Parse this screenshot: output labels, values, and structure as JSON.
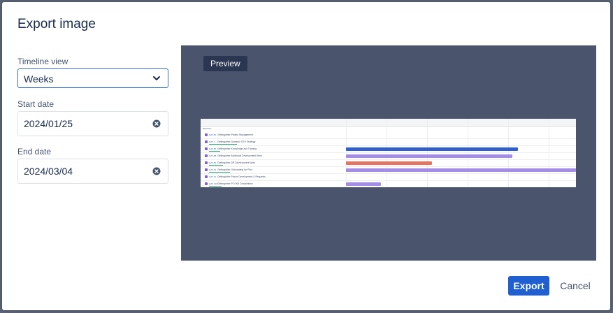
{
  "dialog": {
    "title": "Export image"
  },
  "form": {
    "timeline_view": {
      "label": "Timeline view",
      "value": "Weeks"
    },
    "start_date": {
      "label": "Start date",
      "value": "2024/01/25"
    },
    "end_date": {
      "label": "End date",
      "value": "2024/03/04"
    }
  },
  "preview": {
    "badge": "Preview",
    "column_label": "Releases",
    "rows": [
      {
        "key": "QAT-50",
        "title": "Gettingother Project Management"
      },
      {
        "key": "QAT-1",
        "title": "Gettingother Dynamic CRV Strategy"
      },
      {
        "key": "QAT-86",
        "title": "Gettingother Knowledge and Training"
      },
      {
        "key": "QAT-88",
        "title": "Gettingother Additional Development Work"
      },
      {
        "key": "QAT-89",
        "title": "Gettingother DR Development Work"
      },
      {
        "key": "QAT-90",
        "title": "Gettingother Onboarding for Pilot"
      },
      {
        "key": "QAT-91",
        "title": "Gettingother Future Development & Requests"
      },
      {
        "key": "QAT-100",
        "title": "Gettingother PO 000 Completions"
      }
    ]
  },
  "footer": {
    "export_label": "Export",
    "cancel_label": "Cancel"
  },
  "colors": {
    "primary": "#1f5fd1",
    "bar_blue": "#2f5fd0",
    "bar_purple": "#a48de6",
    "bar_red": "#e8735f"
  }
}
